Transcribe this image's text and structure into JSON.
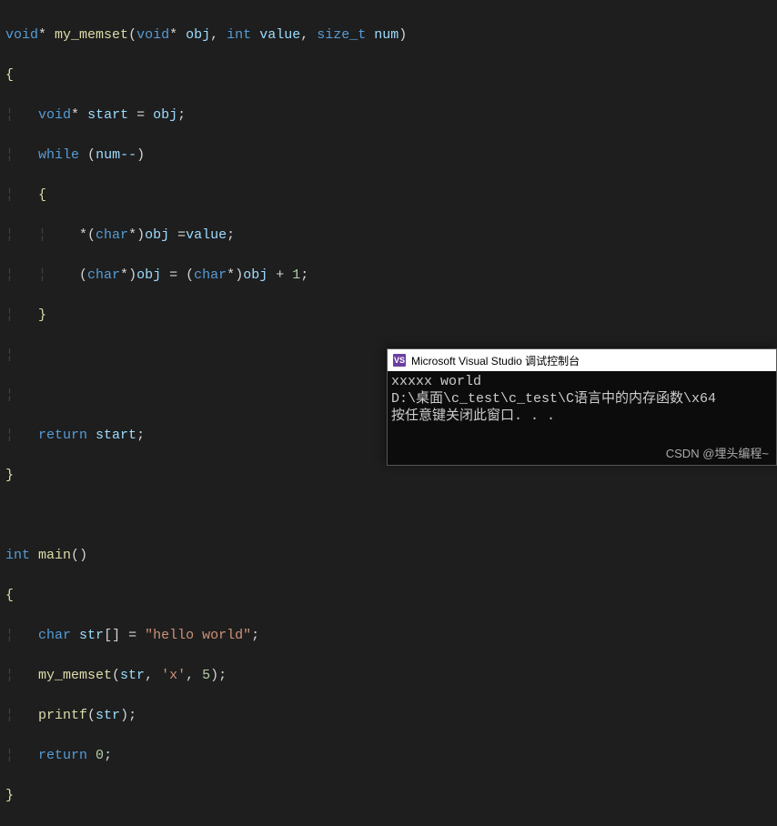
{
  "code": {
    "tokens": {
      "void": "void",
      "star": "*",
      "my_memset": "my_memset",
      "obj": "obj",
      "int": "int",
      "value": "value",
      "size_t": "size_t",
      "num": "num",
      "start": "start",
      "while": "while",
      "numdec": "num--",
      "char": "char",
      "eq": "=",
      "plus": "+",
      "one": "1",
      "return": "return",
      "main": "main",
      "str": "str",
      "hello": "\"hello world\"",
      "xchr": "'x'",
      "five": "5",
      "printf": "printf",
      "zero": "0",
      "semicolon": ";",
      "comma": ",",
      "lparen": "(",
      "rparen": ")",
      "lbrace": "{",
      "rbrace": "}",
      "lbracket": "[",
      "rbracket": "]"
    }
  },
  "console": {
    "title": "Microsoft Visual Studio 调试控制台",
    "icon_text": "VS",
    "lines": {
      "l1": "xxxxx world",
      "l2": "D:\\桌面\\c_test\\c_test\\C语言中的内存函数\\x64",
      "l3": "按任意键关闭此窗口. . ."
    }
  },
  "watermark": "CSDN @埋头编程~"
}
